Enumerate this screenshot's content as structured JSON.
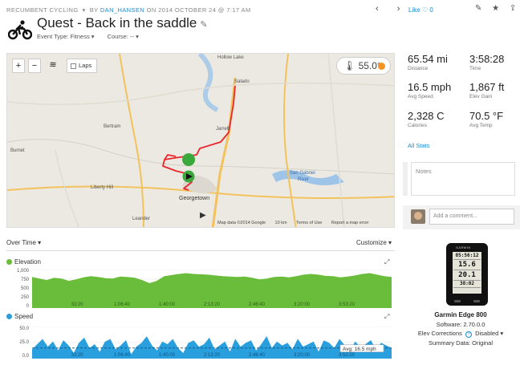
{
  "header": {
    "category": "RECUMBENT CYCLING",
    "by": "BY",
    "user": "DAN_HANSEN",
    "date_text": "ON 2014 OCTOBER 24 @ 7:17 AM",
    "prev_next": "‹ ›",
    "like_label": "Like",
    "like_count": "0",
    "icons": "✎ ★ ⇪ ⚙"
  },
  "activity": {
    "title": "Quest - Back in the saddle",
    "event_type": "Event Type: Fitness ▾",
    "course": "Course: -- ▾"
  },
  "map": {
    "laps_label": "Laps",
    "temperature": "55.0°",
    "footer": [
      "Map data ©2014 Google",
      "10 km",
      "Terms of Use",
      "Report a map error"
    ],
    "places": [
      "Hollow Lake",
      "Salado",
      "Jarrell",
      "Bertram",
      "Burnet",
      "Liberty Hill",
      "Georgetown",
      "Leander",
      "San Gabriel River"
    ],
    "colors": {
      "route": "#e8262c",
      "marker": "#3aa83a",
      "land": "#ece9e2",
      "water": "#9ec4e8",
      "road": "#f3c25c"
    }
  },
  "stats": [
    {
      "value": "65.54 mi",
      "label": "Distance"
    },
    {
      "value": "3:58:28",
      "label": "Time"
    },
    {
      "value": "16.5 mph",
      "label": "Avg Speed"
    },
    {
      "value": "1,867 ft",
      "label": "Elev Gain"
    },
    {
      "value": "2,328 C",
      "label": "Calories"
    },
    {
      "value": "70.5 °F",
      "label": "Avg Temp"
    }
  ],
  "all_stats_link": "All Stats",
  "notes_placeholder": "Notes",
  "comment_placeholder": "Add a comment...",
  "device": {
    "brand": "GARMIN",
    "screen": [
      "05:56:12",
      "15.6",
      "20.1",
      "38:02"
    ],
    "name": "Garmin Edge 800",
    "software": "Software: 2.70.0.0",
    "elev_label": "Elev Corrections",
    "elev_value": "Disabled ▾",
    "summary": "Summary Data: Original"
  },
  "charts": {
    "over_time": "Over Time ▾",
    "customize": "Customize ▾",
    "elevation_label": "Elevation",
    "speed_label": "Speed",
    "avg_speed_label": "Avg: 16.5 mph",
    "elevation_color": "#6abd3a",
    "speed_color": "#2a9fde"
  },
  "chart_data": [
    {
      "type": "area",
      "series": [
        {
          "name": "Elevation"
        }
      ],
      "x": [
        "33:20",
        "1:06:40",
        "1:40:00",
        "2:13:20",
        "2:46:40",
        "3:20:00",
        "3:53:20"
      ],
      "values": [
        800,
        760,
        720,
        780,
        760,
        700,
        740,
        790,
        820,
        800,
        770,
        760,
        810,
        800,
        780,
        720,
        640,
        700,
        820,
        850,
        880,
        900,
        880,
        870,
        860,
        840,
        820,
        810,
        800,
        810,
        780,
        740,
        760,
        800,
        810,
        790,
        820,
        860,
        880,
        860,
        830,
        820,
        790,
        810,
        840,
        880,
        900,
        860,
        820,
        800
      ],
      "yticks": [
        "1,000",
        "750",
        "500",
        "250",
        "0"
      ],
      "ylim": [
        0,
        1000
      ]
    },
    {
      "type": "area",
      "series": [
        {
          "name": "Speed"
        }
      ],
      "x": [
        "33:20",
        "1:06:40",
        "1:40:00",
        "2:13:20",
        "2:46:40",
        "3:20:00",
        "3:53:20"
      ],
      "values": [
        14,
        22,
        30,
        18,
        26,
        12,
        28,
        20,
        8,
        24,
        32,
        16,
        22,
        10,
        26,
        30,
        14,
        20,
        28,
        6,
        18,
        24,
        34,
        20,
        12,
        26,
        22,
        30,
        16,
        8,
        24,
        28,
        18,
        22,
        32,
        14,
        20,
        26,
        10,
        30,
        18,
        24,
        28,
        12,
        22,
        34,
        16,
        26,
        20,
        24,
        14,
        30,
        18,
        22,
        26,
        10,
        28,
        24,
        16,
        30,
        20,
        12,
        26,
        18,
        22,
        28,
        14,
        24,
        20,
        16
      ],
      "yticks": [
        "50.0",
        "25.0",
        "0.0"
      ],
      "ylim": [
        0,
        50
      ],
      "avg": 16.5
    }
  ]
}
